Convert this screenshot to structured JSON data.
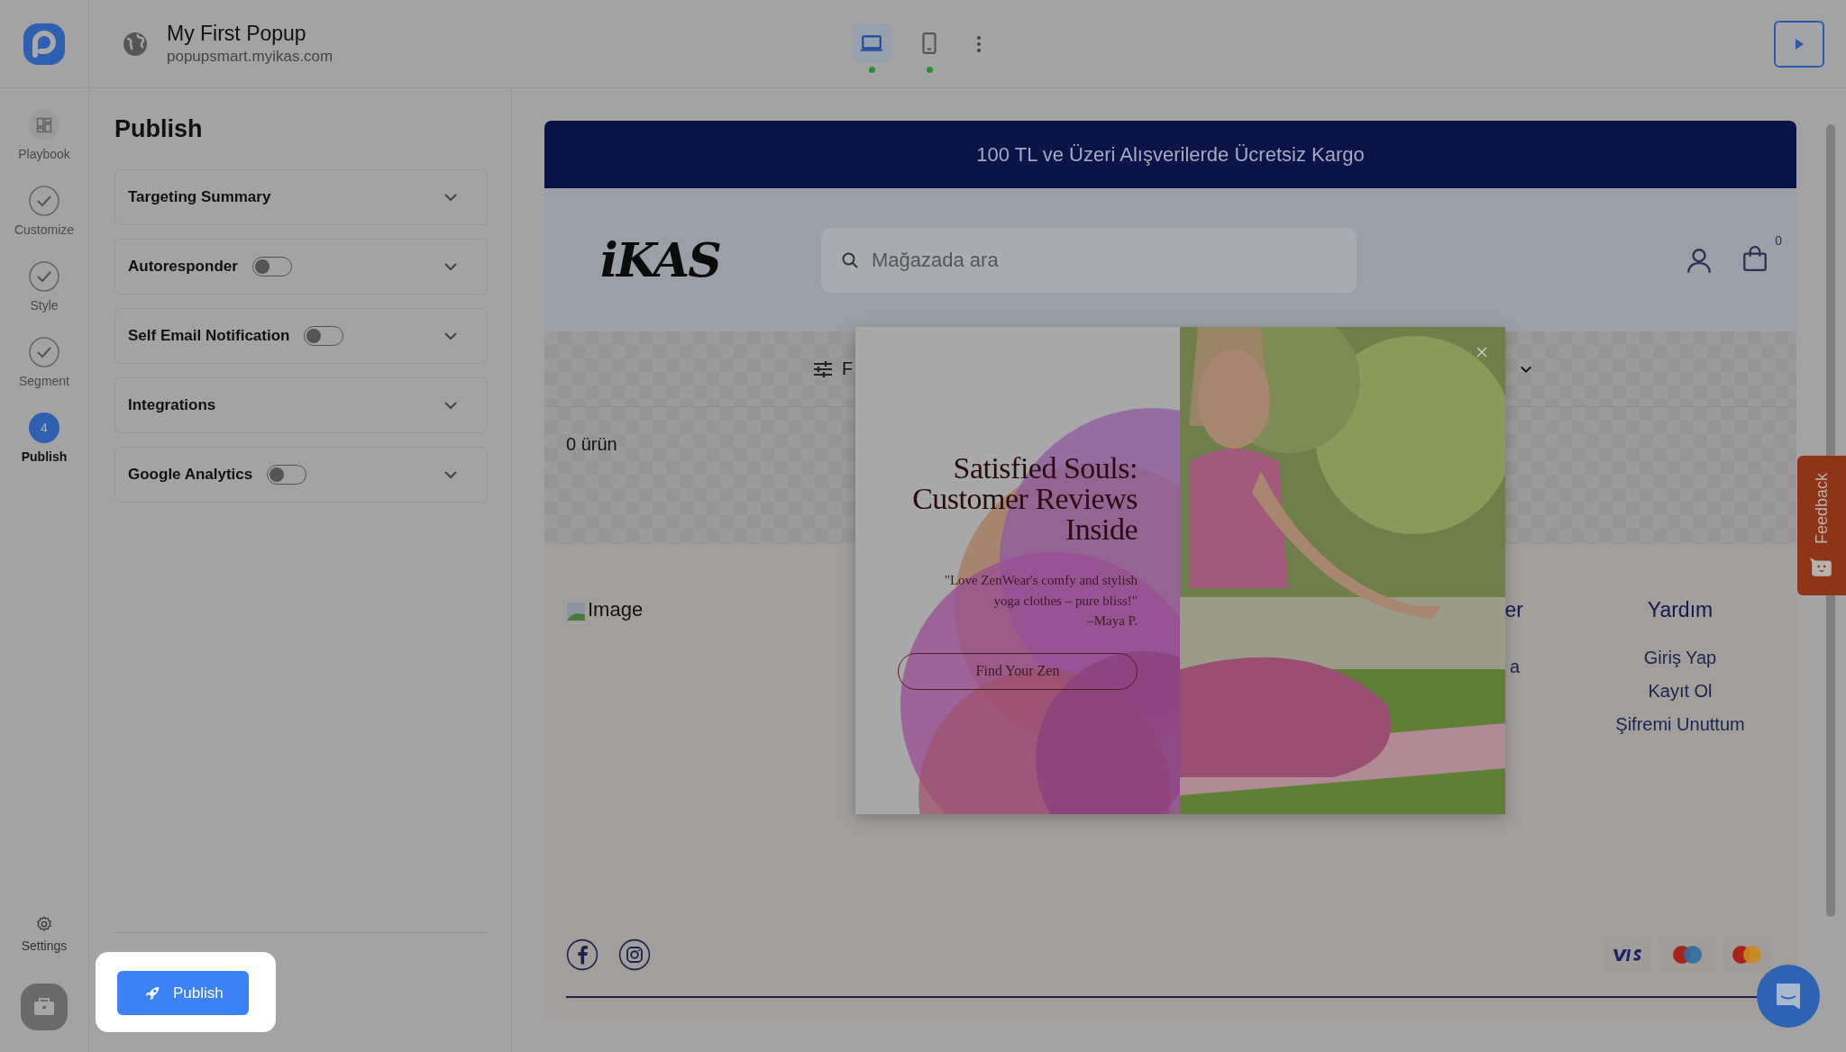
{
  "app": {
    "title": "My First Popup",
    "domain": "popupsmart.myikas.com"
  },
  "devices": [
    {
      "kind": "desktop",
      "selected": true
    },
    {
      "kind": "mobile",
      "selected": false
    }
  ],
  "steps": [
    {
      "label": "Playbook",
      "kind": "grid",
      "selected": false
    },
    {
      "label": "Customize",
      "kind": "done",
      "selected": false
    },
    {
      "label": "Style",
      "kind": "done",
      "selected": false
    },
    {
      "label": "Segment",
      "kind": "done",
      "selected": false
    },
    {
      "label": "Publish",
      "kind": "number",
      "number": "4",
      "selected": true
    }
  ],
  "settings_label": "Settings",
  "panel": {
    "title": "Publish",
    "sections": [
      {
        "label": "Targeting Summary",
        "kind": "plain"
      },
      {
        "label": "Autoresponder",
        "kind": "toggle",
        "on": false
      },
      {
        "label": "Self Email Notification",
        "kind": "toggle",
        "on": false
      },
      {
        "label": "Integrations",
        "kind": "plain"
      },
      {
        "label": "Google Analytics",
        "kind": "toggle",
        "on": false
      }
    ],
    "publish_button": "Publish"
  },
  "store": {
    "banner": "100 TL ve Üzeri Alışverilerde Ücretsiz Kargo",
    "logo": "iKAS",
    "search_placeholder": "Mağazada ara",
    "cart_count": "0",
    "filter_label": "F",
    "product_count": "0 ürün",
    "footer": {
      "image_alt": "Image",
      "partial_heading": "er",
      "partial_link": "a",
      "help_heading": "Yardım",
      "help_links": [
        "Giriş Yap",
        "Kayıt Ol",
        "Şifremi Unuttum"
      ]
    }
  },
  "popup": {
    "heading": "Satisfied Souls:\nCustomer Reviews\nInside",
    "quote": "\"Love ZenWear's comfy and stylish\nyoga clothes – pure bliss!\"",
    "author": "–Maya P.",
    "button": "Find Your Zen"
  },
  "feedback": "Feedback"
}
